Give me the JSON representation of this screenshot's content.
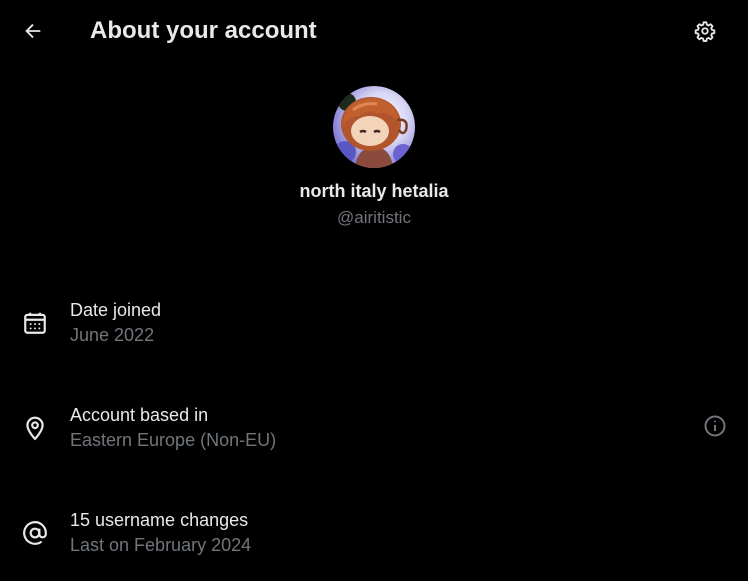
{
  "header": {
    "title": "About your account",
    "back_icon": "arrow-left-icon",
    "settings_icon": "gear-icon"
  },
  "profile": {
    "display_name": "north italy hetalia",
    "handle": "@airitistic",
    "avatar_icon": "avatar"
  },
  "details": [
    {
      "icon": "calendar-icon",
      "title": "Date joined",
      "value": "June 2022"
    },
    {
      "icon": "location-pin-icon",
      "title": "Account based in",
      "value": "Eastern Europe (Non-EU)",
      "info_icon": "info-icon"
    },
    {
      "icon": "at-sign-icon",
      "title": "15 username changes",
      "value": "Last on February 2024"
    }
  ],
  "colors": {
    "background": "#000000",
    "primary_text": "#e7e9ea",
    "secondary_text": "#71767b"
  }
}
